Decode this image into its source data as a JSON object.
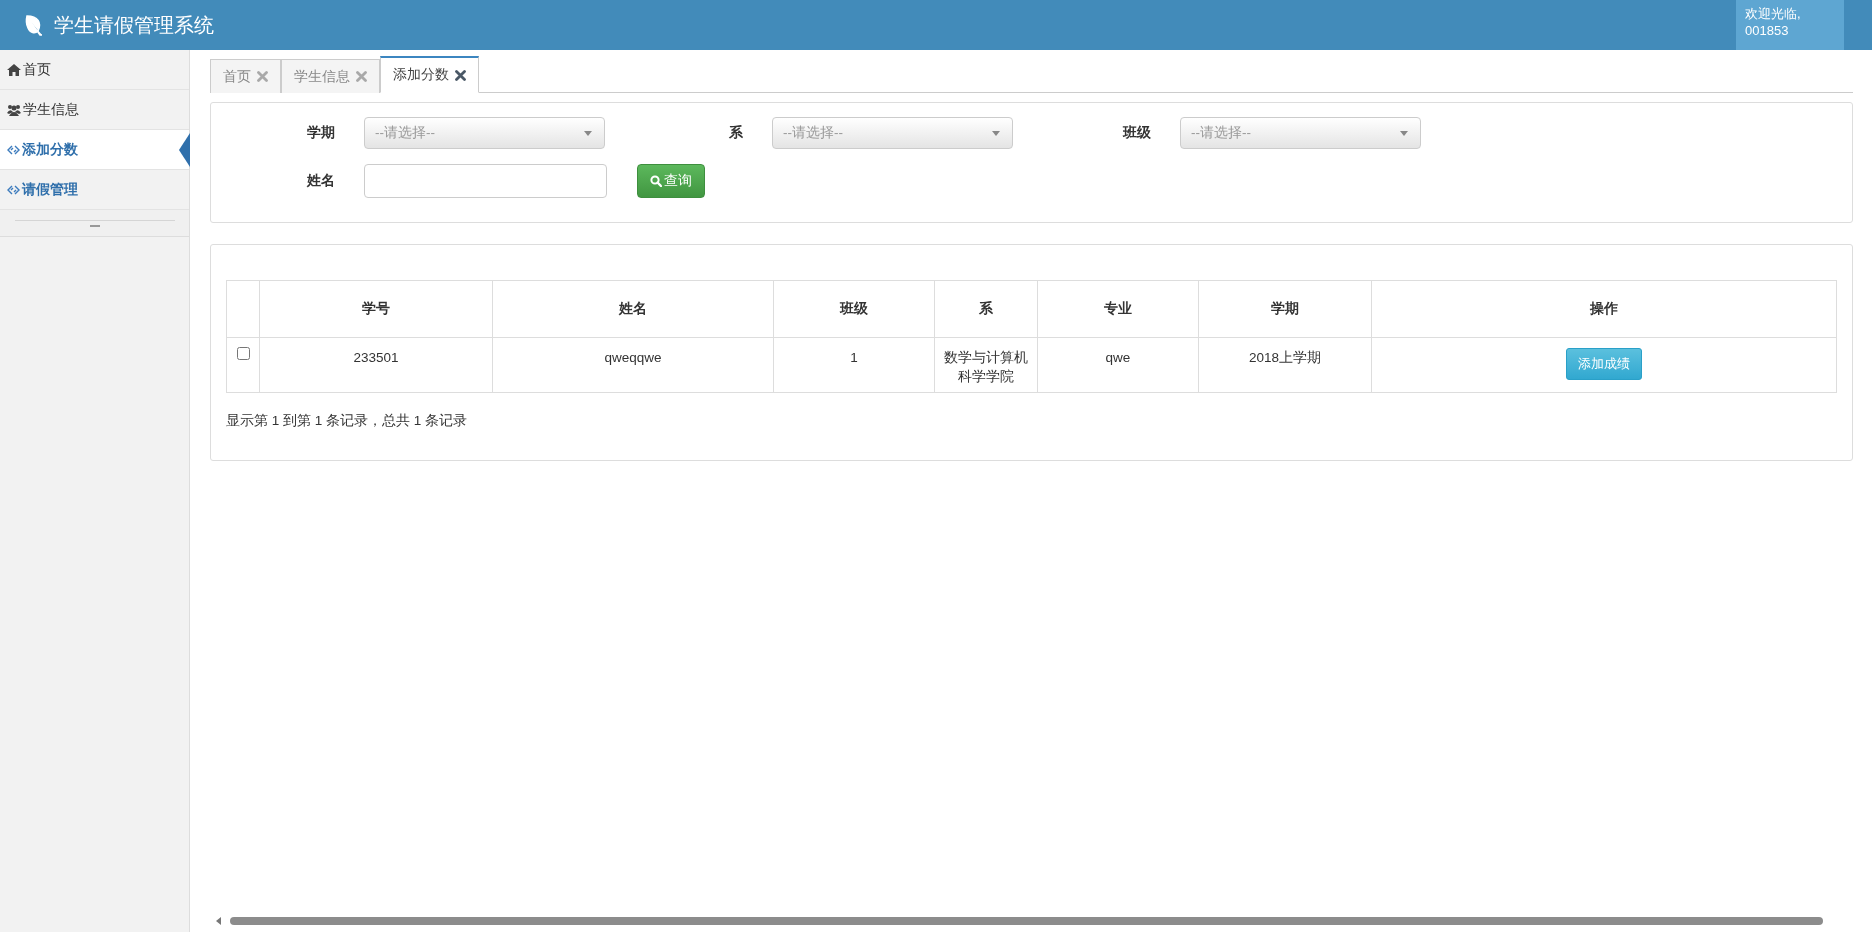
{
  "header": {
    "title": "学生请假管理系统",
    "welcome": "欢迎光临,",
    "user": "001853"
  },
  "sidebar": {
    "items": [
      {
        "label": "首页",
        "kind": "home",
        "selected": false
      },
      {
        "label": "学生信息",
        "kind": "users",
        "selected": false
      },
      {
        "label": "添加分数",
        "kind": "link",
        "selected": true
      },
      {
        "label": "请假管理",
        "kind": "link",
        "selected": false
      }
    ]
  },
  "tabs": [
    {
      "label": "首页",
      "selected": false
    },
    {
      "label": "学生信息",
      "selected": false
    },
    {
      "label": "添加分数",
      "selected": true
    }
  ],
  "filters": {
    "selects": [
      {
        "label": "学期",
        "placeholder": "--请选择--"
      },
      {
        "label": "系",
        "placeholder": "--请选择--"
      },
      {
        "label": "班级",
        "placeholder": "--请选择--"
      }
    ],
    "name": {
      "label": "姓名"
    },
    "search_button": "查询"
  },
  "table": {
    "columns": [
      "学号",
      "姓名",
      "班级",
      "系",
      "专业",
      "学期",
      "操作"
    ],
    "rows": [
      {
        "checked": false,
        "cells": [
          "233501",
          "qweqqwe",
          "1",
          "数学与计算机科学学院",
          "qwe",
          "2018上学期"
        ],
        "action": "添加成绩"
      }
    ]
  },
  "pagination_text": "显示第 1 到第 1 条记录，总共 1 条记录"
}
